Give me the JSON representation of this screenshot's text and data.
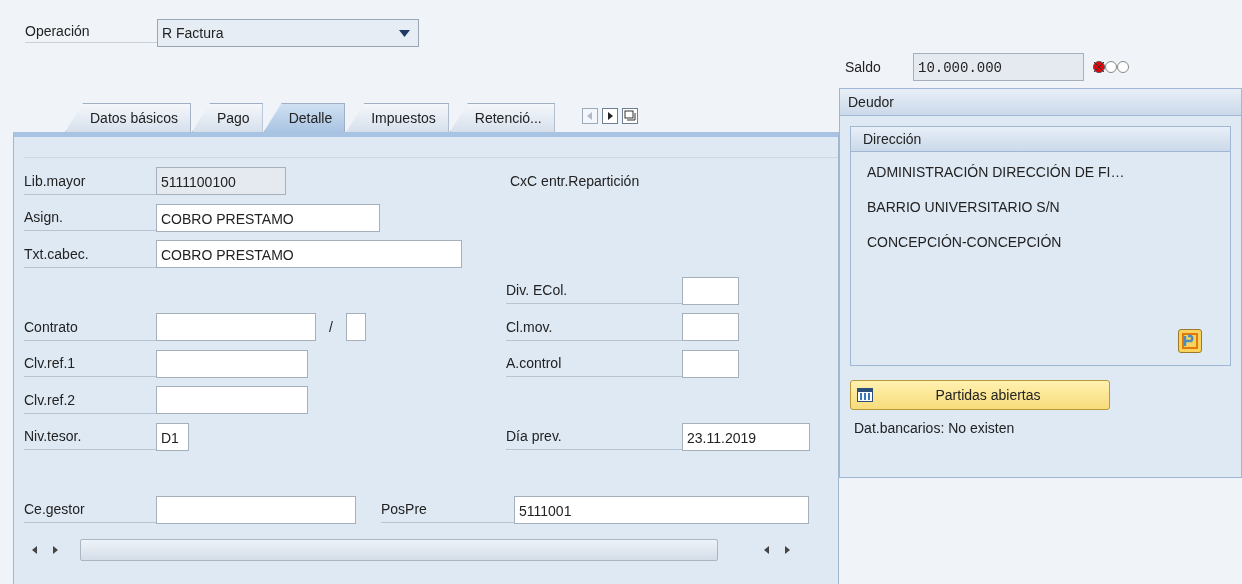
{
  "operation": {
    "label": "Operación",
    "value": "R Factura"
  },
  "tabs": [
    {
      "label": "Datos básicos",
      "selected": false
    },
    {
      "label": "Pago",
      "selected": false
    },
    {
      "label": "Detalle",
      "selected": true
    },
    {
      "label": "Impuestos",
      "selected": false
    },
    {
      "label": "Retenció...",
      "selected": false
    }
  ],
  "form": {
    "rows": [
      {
        "left": {
          "label": "Lib.mayor",
          "fields": [
            {
              "value": "5111100100",
              "readonly": true
            }
          ]
        },
        "right": {
          "text": "CxC entr.Repartición"
        }
      },
      {
        "left": {
          "label": "Asign.",
          "fields": [
            {
              "value": "COBRO PRESTAMO",
              "readonly": false
            }
          ]
        }
      },
      {
        "left": {
          "label": "Txt.cabec.",
          "fields": [
            {
              "value": "COBRO PRESTAMO",
              "readonly": false
            }
          ]
        }
      },
      {
        "right": {
          "label": "Div. ECol.",
          "fields": [
            {
              "readonly": false
            }
          ]
        }
      },
      {
        "left": {
          "label": "Contrato",
          "fields": [
            {
              "readonly": false
            },
            {
              "readonly": false
            }
          ],
          "separator": "/"
        },
        "right": {
          "label": "Cl.mov.",
          "fields": [
            {
              "readonly": false
            }
          ]
        }
      },
      {
        "left": {
          "label": "Clv.ref.1",
          "fields": [
            {
              "readonly": false
            }
          ]
        },
        "right": {
          "label": "A.control",
          "fields": [
            {
              "readonly": false
            }
          ]
        }
      },
      {
        "left": {
          "label": "Clv.ref.2",
          "fields": [
            {
              "readonly": false
            }
          ]
        }
      },
      {
        "left": {
          "label": "Niv.tesor.",
          "fields": [
            {
              "value": "D1",
              "readonly": false
            }
          ]
        },
        "right": {
          "label": "Día prev.",
          "fields": [
            {
              "value": "23.11.2019",
              "readonly": false
            }
          ]
        }
      },
      {},
      {
        "left": {
          "label": "Ce.gestor",
          "fields": [
            {
              "readonly": false
            }
          ]
        },
        "right": {
          "label": "PosPre",
          "fields": [
            {
              "value": "5111001",
              "readonly": false
            }
          ]
        }
      }
    ]
  },
  "saldo": {
    "label": "Saldo",
    "value": "10.000.000"
  },
  "deudor": {
    "title": "Deudor",
    "direccion": {
      "title": "Dirección",
      "lines": [
        "ADMINISTRACIÓN DIRECCIÓN DE FI…",
        "BARRIO UNIVERSITARIO S/N",
        "CONCEPCIÓN-CONCEPCIÓN"
      ]
    },
    "button": "Partidas abiertas",
    "bank_info": "Dat.bancarios: No existen"
  }
}
